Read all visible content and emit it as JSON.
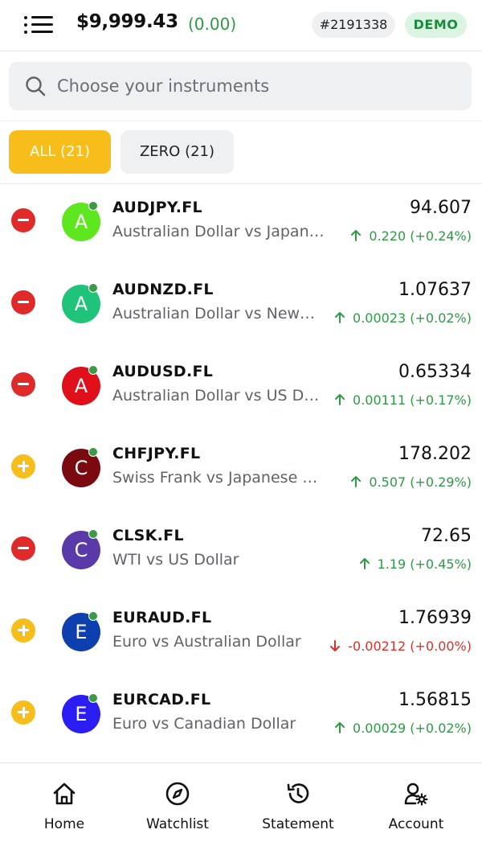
{
  "header": {
    "balance": "$9,999.43",
    "balance_change": "(0.00)",
    "account_id": "#2191338",
    "mode_badge": "DEMO"
  },
  "search": {
    "placeholder": "Choose your instruments"
  },
  "filters": {
    "all_label": "ALL (21)",
    "zero_label": "ZERO (21)"
  },
  "instruments": [
    {
      "action": "remove",
      "letter": "A",
      "avatar_color": "#5ee61e",
      "symbol": "AUDJPY.FL",
      "description": "Australian Dollar vs Japan…",
      "price": "94.607",
      "change": "0.220 (+0.24%)",
      "direction": "up"
    },
    {
      "action": "remove",
      "letter": "A",
      "avatar_color": "#1fc47a",
      "symbol": "AUDNZD.FL",
      "description": "Australian Dollar vs New…",
      "price": "1.07637",
      "change": "0.00023 (+0.02%)",
      "direction": "up"
    },
    {
      "action": "remove",
      "letter": "A",
      "avatar_color": "#e0101b",
      "symbol": "AUDUSD.FL",
      "description": "Australian Dollar vs US D…",
      "price": "0.65334",
      "change": "0.00111 (+0.17%)",
      "direction": "up"
    },
    {
      "action": "add",
      "letter": "C",
      "avatar_color": "#7a0a0f",
      "symbol": "CHFJPY.FL",
      "description": "Swiss Frank vs Japanese …",
      "price": "178.202",
      "change": "0.507 (+0.29%)",
      "direction": "up"
    },
    {
      "action": "remove",
      "letter": "C",
      "avatar_color": "#5a3aa8",
      "symbol": "CLSK.FL",
      "description": "WTI vs US Dollar",
      "price": "72.65",
      "change": "1.19 (+0.45%)",
      "direction": "up"
    },
    {
      "action": "add",
      "letter": "E",
      "avatar_color": "#0e3fae",
      "symbol": "EURAUD.FL",
      "description": "Euro vs Australian Dollar",
      "price": "1.76939",
      "change": "-0.00212 (+0.00%)",
      "direction": "down"
    },
    {
      "action": "add",
      "letter": "E",
      "avatar_color": "#2a1ef5",
      "symbol": "EURCAD.FL",
      "description": "Euro vs Canadian Dollar",
      "price": "1.56815",
      "change": "0.00029 (+0.02%)",
      "direction": "up"
    }
  ],
  "nav": {
    "home": "Home",
    "watchlist": "Watchlist",
    "statement": "Statement",
    "account": "Account"
  },
  "colors": {
    "accent": "#f7bd1a",
    "positive": "#2e9a46",
    "negative": "#d8312b",
    "remove": "#e02a2a",
    "online": "#3a9a46"
  },
  "icons": {
    "menu": "menu-list-icon",
    "search": "search-icon",
    "home": "home-icon",
    "watchlist": "compass-icon",
    "statement": "history-icon",
    "account": "user-settings-icon"
  }
}
